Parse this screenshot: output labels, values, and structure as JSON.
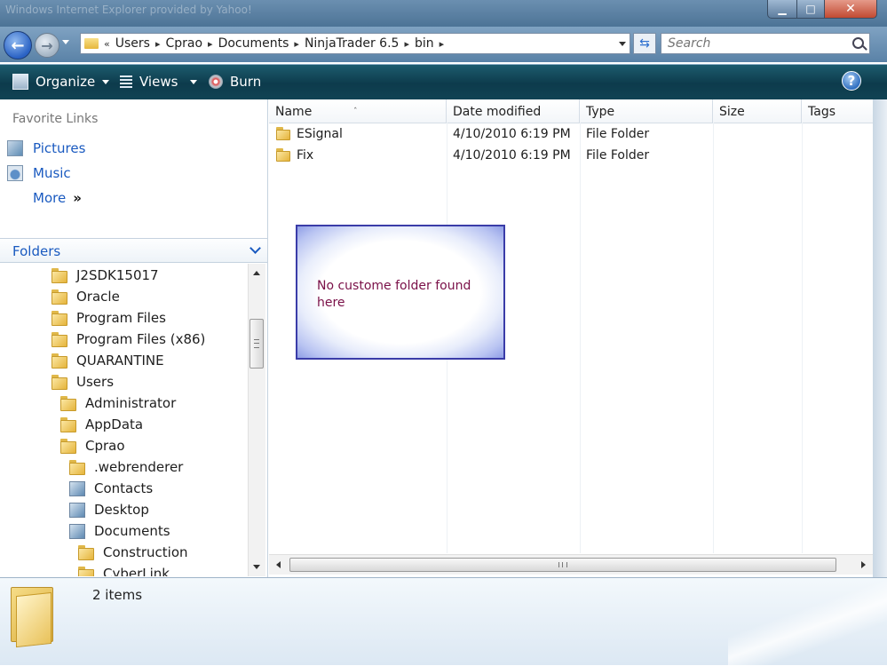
{
  "window": {
    "title": "Windows Internet Explorer provided by Yahoo!",
    "controls": {
      "minimize": "▁",
      "maximize": "□",
      "close": "✕"
    }
  },
  "address": {
    "overflow": "«",
    "crumbs": [
      "Users",
      "Cprao",
      "Documents",
      "NinjaTrader 6.5",
      "bin"
    ],
    "search_placeholder": "Search"
  },
  "toolbar": {
    "organize": "Organize",
    "views": "Views",
    "burn": "Burn",
    "help": "?"
  },
  "nav": {
    "favorites_title": "Favorite Links",
    "favorites": [
      {
        "label": "Pictures",
        "icon": "pictures-icon"
      },
      {
        "label": "Music",
        "icon": "music-icon"
      }
    ],
    "more": "More",
    "more_chevron": "»",
    "folders_title": "Folders",
    "tree": [
      {
        "label": "J2SDK15017",
        "icon": "folder-icon"
      },
      {
        "label": "Oracle",
        "icon": "folder-icon"
      },
      {
        "label": "Program Files",
        "icon": "folder-icon"
      },
      {
        "label": "Program Files (x86)",
        "icon": "folder-icon"
      },
      {
        "label": "QUARANTINE",
        "icon": "folder-icon"
      },
      {
        "label": "Users",
        "icon": "folder-icon"
      },
      {
        "label": "Administrator",
        "icon": "folder-icon"
      },
      {
        "label": "AppData",
        "icon": "folder-icon"
      },
      {
        "label": "Cprao",
        "icon": "folder-icon"
      },
      {
        "label": ".webrenderer",
        "icon": "folder-icon"
      },
      {
        "label": "Contacts",
        "icon": "contacts-icon"
      },
      {
        "label": "Desktop",
        "icon": "desktop-icon"
      },
      {
        "label": "Documents",
        "icon": "documents-icon"
      },
      {
        "label": "Construction",
        "icon": "folder-icon"
      },
      {
        "label": "CyberLink",
        "icon": "folder-icon"
      }
    ]
  },
  "files": {
    "columns": [
      "Name",
      "Date modified",
      "Type",
      "Size",
      "Tags"
    ],
    "rows": [
      {
        "name": "ESignal",
        "date": "4/10/2010 6:19 PM",
        "type": "File Folder",
        "size": ""
      },
      {
        "name": "Fix",
        "date": "4/10/2010 6:19 PM",
        "type": "File Folder",
        "size": ""
      }
    ],
    "sort_indicator": "ˆ"
  },
  "callout": {
    "text": "No custome folder found here"
  },
  "details": {
    "count": "2 items"
  }
}
